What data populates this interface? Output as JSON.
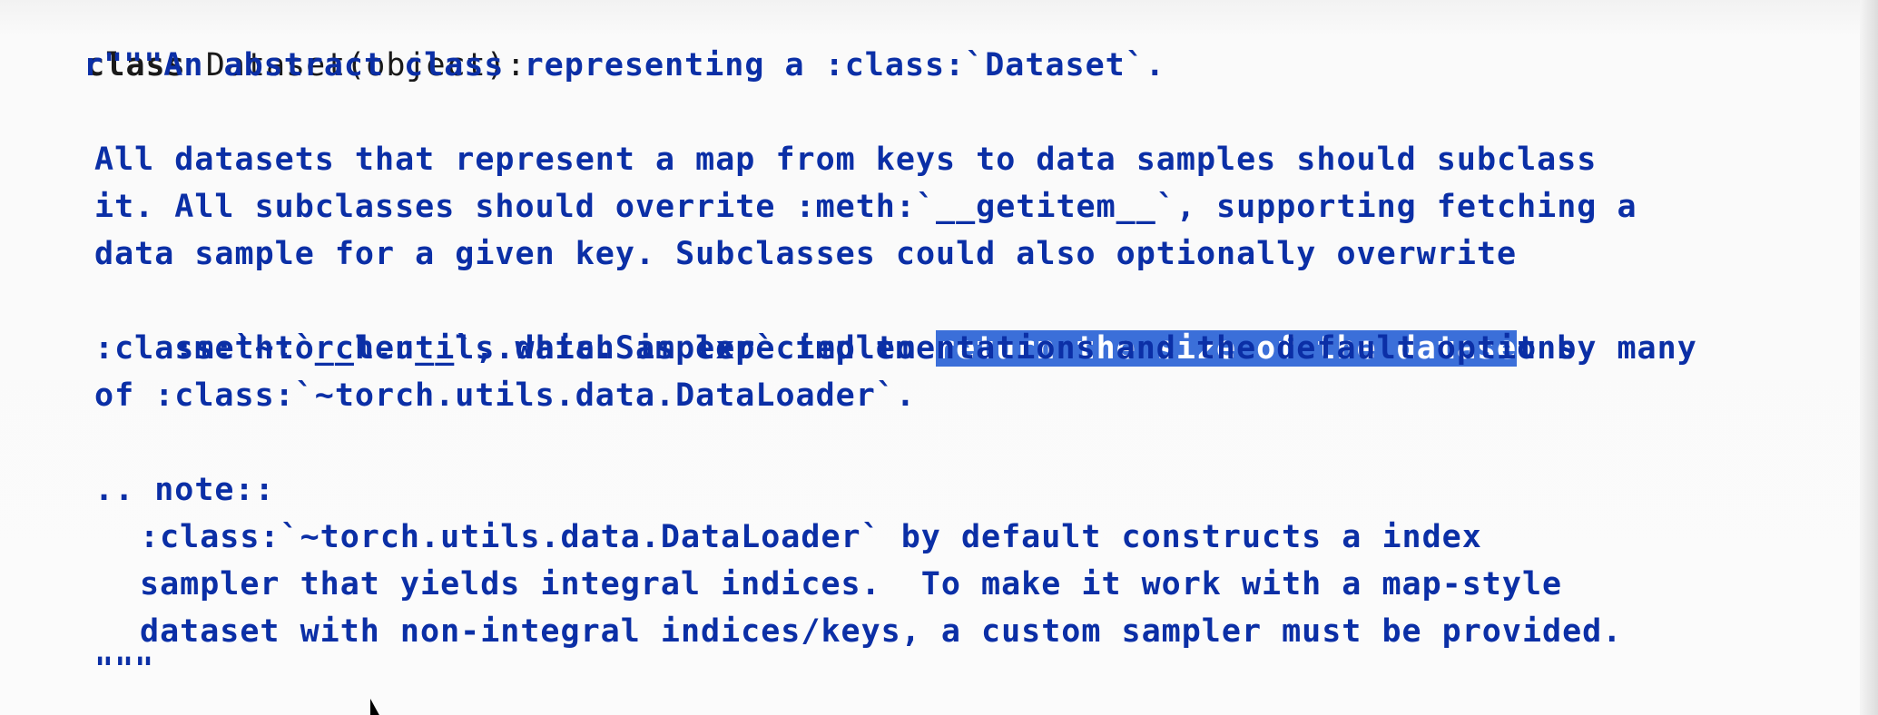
{
  "code": {
    "line1": {
      "keyword": "class",
      "name": " Dataset(object):"
    },
    "line2": "r\"\"\"An abstract class representing a :class:`Dataset`.",
    "line3": "All datasets that represent a map from keys to data samples should subclass",
    "line4": "it. All subclasses should overrite :meth:`__getitem__`, supporting fetching a",
    "line5": "data sample for a given key. Subclasses could also optionally overwrite",
    "line6": {
      "before": ":meth:`__len__`, which is expected to ",
      "selected": "return the size of the datase",
      "after": "t by many"
    },
    "line7": ":class:`~torch.utils.data.Sampler` implementations and the default options",
    "line8": "of :class:`~torch.utils.data.DataLoader`.",
    "line9": ".. note::",
    "line10": ":class:`~torch.utils.data.DataLoader` by default constructs a index",
    "line11": "sampler that yields integral indices.  To make it work with a map-style",
    "line12": "dataset with non-integral indices/keys, a custom sampler must be provided.",
    "line13": "\"\"\""
  }
}
